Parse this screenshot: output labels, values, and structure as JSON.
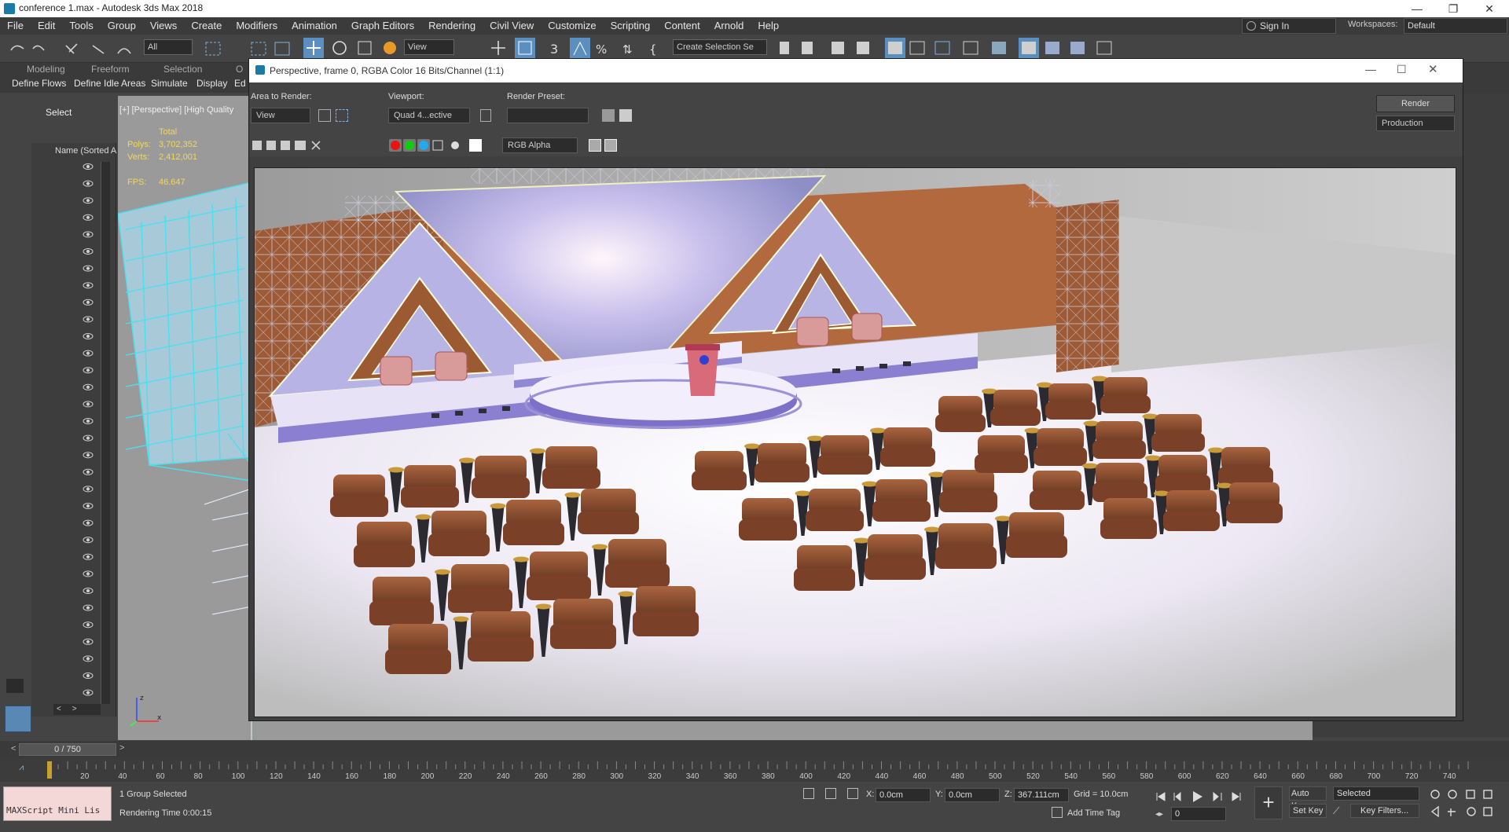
{
  "window": {
    "title": "conference 1.max - Autodesk 3ds Max 2018"
  },
  "menu": [
    "File",
    "Edit",
    "Tools",
    "Group",
    "Views",
    "Create",
    "Modifiers",
    "Animation",
    "Graph Editors",
    "Rendering",
    "Civil View",
    "Customize",
    "Scripting",
    "Content",
    "Arnold",
    "Help"
  ],
  "account": {
    "sign_in": "Sign In",
    "workspaces_label": "Workspaces:",
    "workspace": "Default"
  },
  "toolbar": {
    "filter": "All",
    "ref_coord": "View",
    "selection_set": "Create Selection Se"
  },
  "ribbon": {
    "tabs": [
      "Modeling",
      "Freeform",
      "Selection",
      "O"
    ],
    "buttons": [
      "Define Flows",
      "Define Idle Areas",
      "Simulate",
      "Display",
      "Ed"
    ]
  },
  "scene_explorer": {
    "select_label": "Select",
    "name_header": "Name (Sorted A"
  },
  "viewport": {
    "label": "[+] [Perspective] [High Quality",
    "stats_total": "Total",
    "polys_label": "Polys:",
    "polys": "3,702,352",
    "verts_label": "Verts:",
    "verts": "2,412,001",
    "fps_label": "FPS:",
    "fps": "46.647"
  },
  "render_window": {
    "title": "Perspective, frame 0, RGBA Color 16 Bits/Channel (1:1)",
    "area_label": "Area to Render:",
    "area_value": "View",
    "viewport_label": "Viewport:",
    "viewport_value": "Quad 4...ective",
    "preset_label": "Render Preset:",
    "preset_value": "",
    "render_button": "Render",
    "production": "Production",
    "channel": "RGB Alpha"
  },
  "timeline": {
    "frame": "0 / 750",
    "ticks": [
      "20",
      "40",
      "60",
      "80",
      "100",
      "120",
      "140",
      "160",
      "180",
      "200",
      "220",
      "240",
      "260",
      "280",
      "300",
      "320",
      "340",
      "360",
      "380",
      "400",
      "420",
      "440",
      "460",
      "480",
      "500",
      "520",
      "540",
      "560",
      "580",
      "600",
      "620",
      "640",
      "660",
      "680",
      "700",
      "720",
      "740"
    ]
  },
  "status": {
    "maxscript": "MAXScript Mini Lis",
    "selected": "1 Group Selected",
    "rendering_time": "Rendering Time  0:00:15",
    "x_label": "X:",
    "x": "0.0cm",
    "y_label": "Y:",
    "y": "0.0cm",
    "z_label": "Z:",
    "z": "367.111cm",
    "grid": "Grid = 10.0cm",
    "add_time_tag": "Add Time Tag",
    "auto_key": "Auto Key",
    "set_key": "Set Key",
    "selected_dd": "Selected",
    "key_filters": "Key Filters...",
    "frame_field": "0"
  }
}
